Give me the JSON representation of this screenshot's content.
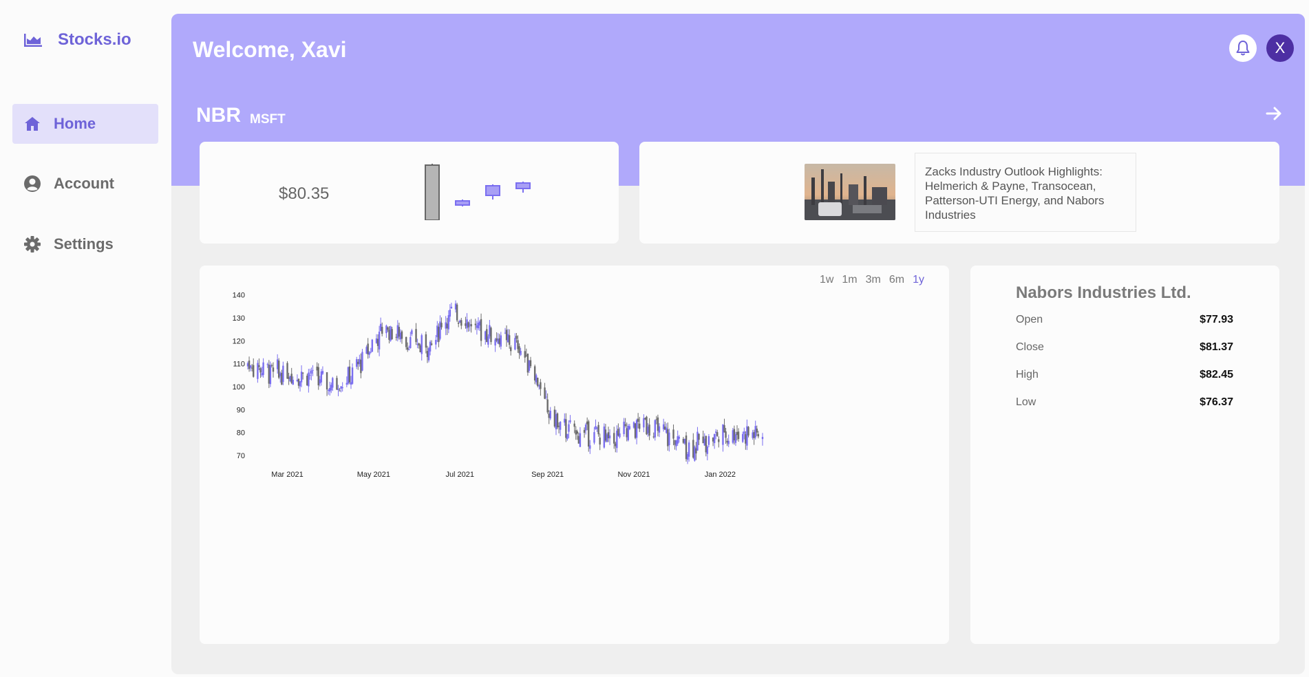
{
  "app": {
    "name": "Stocks.io"
  },
  "sidebar": {
    "items": [
      {
        "label": "Home",
        "icon": "home-icon"
      },
      {
        "label": "Account",
        "icon": "user-circle-icon"
      },
      {
        "label": "Settings",
        "icon": "gear-icon"
      }
    ]
  },
  "header": {
    "welcome": "Welcome, Xavi",
    "avatar_initial": "X",
    "ticker": "NBR",
    "ticker_secondary": "MSFT"
  },
  "price_card": {
    "price": "$80.35"
  },
  "news": {
    "headline": "Zacks Industry Outlook Highlights: Helmerich & Payne, Transocean, Patterson-UTI Energy, and Nabors Industries"
  },
  "range_tabs": [
    "1w",
    "1m",
    "3m",
    "6m",
    "1y"
  ],
  "range_selected": "1y",
  "company": {
    "name": "Nabors Industries Ltd.",
    "rows": [
      {
        "label": "Open",
        "value": "$77.93"
      },
      {
        "label": "Close",
        "value": "$81.37"
      },
      {
        "label": "High",
        "value": "$82.45"
      },
      {
        "label": "Low",
        "value": "$76.37"
      }
    ]
  },
  "colors": {
    "accent": "#6e63d8",
    "hero": "#b0a9fb",
    "up": "#7a6ef0",
    "down": "#6b6b6b"
  },
  "chart_data": {
    "type": "candlestick",
    "title": "",
    "xlabel": "",
    "ylabel": "",
    "x_ticks": [
      "Mar 2021",
      "May 2021",
      "Jul 2021",
      "Sep 2021",
      "Nov 2021",
      "Jan 2022"
    ],
    "y_ticks": [
      140,
      130,
      120,
      110,
      100,
      90,
      80,
      70
    ],
    "ylim": [
      67,
      142
    ],
    "x_range": [
      "2021-02-01",
      "2022-01-31"
    ],
    "grid": false,
    "series": [
      {
        "trend_points": [
          [
            "2021-02-01",
            110
          ],
          [
            "2021-02-15",
            107
          ],
          [
            "2021-03-01",
            105
          ],
          [
            "2021-03-15",
            106
          ],
          [
            "2021-04-01",
            100
          ],
          [
            "2021-04-15",
            104
          ],
          [
            "2021-05-01",
            120
          ],
          [
            "2021-05-10",
            126
          ],
          [
            "2021-05-20",
            122
          ],
          [
            "2021-06-01",
            118
          ],
          [
            "2021-06-10",
            118
          ],
          [
            "2021-06-20",
            130
          ],
          [
            "2021-07-01",
            132
          ],
          [
            "2021-07-10",
            126
          ],
          [
            "2021-07-20",
            124
          ],
          [
            "2021-08-01",
            120
          ],
          [
            "2021-08-10",
            118
          ],
          [
            "2021-08-20",
            110
          ],
          [
            "2021-09-01",
            90
          ],
          [
            "2021-09-10",
            82
          ],
          [
            "2021-09-20",
            80
          ],
          [
            "2021-10-01",
            80
          ],
          [
            "2021-10-15",
            77
          ],
          [
            "2021-11-01",
            82
          ],
          [
            "2021-11-10",
            84
          ],
          [
            "2021-11-20",
            80
          ],
          [
            "2021-12-01",
            76
          ],
          [
            "2021-12-10",
            74
          ],
          [
            "2021-12-20",
            76
          ],
          [
            "2022-01-01",
            79
          ],
          [
            "2022-01-15",
            80
          ],
          [
            "2022-01-31",
            79
          ]
        ]
      }
    ],
    "mini_candles": [
      {
        "open": 90,
        "close": 10,
        "high": 96,
        "low": 8,
        "dir": "down"
      },
      {
        "open": 62,
        "close": 68,
        "high": 60,
        "low": 70,
        "dir": "up"
      },
      {
        "open": 54,
        "close": 40,
        "high": 38,
        "low": 60,
        "dir": "up"
      },
      {
        "open": 44,
        "close": 36,
        "high": 34,
        "low": 50,
        "dir": "up"
      }
    ]
  }
}
